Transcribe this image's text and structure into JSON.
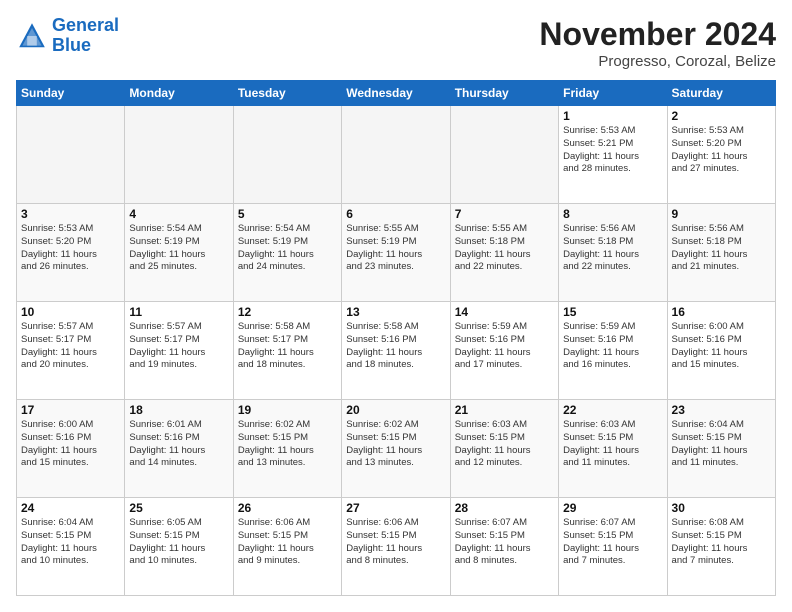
{
  "header": {
    "logo_line1": "General",
    "logo_line2": "Blue",
    "month_title": "November 2024",
    "location": "Progresso, Corozal, Belize"
  },
  "weekdays": [
    "Sunday",
    "Monday",
    "Tuesday",
    "Wednesday",
    "Thursday",
    "Friday",
    "Saturday"
  ],
  "weeks": [
    [
      {
        "day": "",
        "info": ""
      },
      {
        "day": "",
        "info": ""
      },
      {
        "day": "",
        "info": ""
      },
      {
        "day": "",
        "info": ""
      },
      {
        "day": "",
        "info": ""
      },
      {
        "day": "1",
        "info": "Sunrise: 5:53 AM\nSunset: 5:21 PM\nDaylight: 11 hours\nand 28 minutes."
      },
      {
        "day": "2",
        "info": "Sunrise: 5:53 AM\nSunset: 5:20 PM\nDaylight: 11 hours\nand 27 minutes."
      }
    ],
    [
      {
        "day": "3",
        "info": "Sunrise: 5:53 AM\nSunset: 5:20 PM\nDaylight: 11 hours\nand 26 minutes."
      },
      {
        "day": "4",
        "info": "Sunrise: 5:54 AM\nSunset: 5:19 PM\nDaylight: 11 hours\nand 25 minutes."
      },
      {
        "day": "5",
        "info": "Sunrise: 5:54 AM\nSunset: 5:19 PM\nDaylight: 11 hours\nand 24 minutes."
      },
      {
        "day": "6",
        "info": "Sunrise: 5:55 AM\nSunset: 5:19 PM\nDaylight: 11 hours\nand 23 minutes."
      },
      {
        "day": "7",
        "info": "Sunrise: 5:55 AM\nSunset: 5:18 PM\nDaylight: 11 hours\nand 22 minutes."
      },
      {
        "day": "8",
        "info": "Sunrise: 5:56 AM\nSunset: 5:18 PM\nDaylight: 11 hours\nand 22 minutes."
      },
      {
        "day": "9",
        "info": "Sunrise: 5:56 AM\nSunset: 5:18 PM\nDaylight: 11 hours\nand 21 minutes."
      }
    ],
    [
      {
        "day": "10",
        "info": "Sunrise: 5:57 AM\nSunset: 5:17 PM\nDaylight: 11 hours\nand 20 minutes."
      },
      {
        "day": "11",
        "info": "Sunrise: 5:57 AM\nSunset: 5:17 PM\nDaylight: 11 hours\nand 19 minutes."
      },
      {
        "day": "12",
        "info": "Sunrise: 5:58 AM\nSunset: 5:17 PM\nDaylight: 11 hours\nand 18 minutes."
      },
      {
        "day": "13",
        "info": "Sunrise: 5:58 AM\nSunset: 5:16 PM\nDaylight: 11 hours\nand 18 minutes."
      },
      {
        "day": "14",
        "info": "Sunrise: 5:59 AM\nSunset: 5:16 PM\nDaylight: 11 hours\nand 17 minutes."
      },
      {
        "day": "15",
        "info": "Sunrise: 5:59 AM\nSunset: 5:16 PM\nDaylight: 11 hours\nand 16 minutes."
      },
      {
        "day": "16",
        "info": "Sunrise: 6:00 AM\nSunset: 5:16 PM\nDaylight: 11 hours\nand 15 minutes."
      }
    ],
    [
      {
        "day": "17",
        "info": "Sunrise: 6:00 AM\nSunset: 5:16 PM\nDaylight: 11 hours\nand 15 minutes."
      },
      {
        "day": "18",
        "info": "Sunrise: 6:01 AM\nSunset: 5:16 PM\nDaylight: 11 hours\nand 14 minutes."
      },
      {
        "day": "19",
        "info": "Sunrise: 6:02 AM\nSunset: 5:15 PM\nDaylight: 11 hours\nand 13 minutes."
      },
      {
        "day": "20",
        "info": "Sunrise: 6:02 AM\nSunset: 5:15 PM\nDaylight: 11 hours\nand 13 minutes."
      },
      {
        "day": "21",
        "info": "Sunrise: 6:03 AM\nSunset: 5:15 PM\nDaylight: 11 hours\nand 12 minutes."
      },
      {
        "day": "22",
        "info": "Sunrise: 6:03 AM\nSunset: 5:15 PM\nDaylight: 11 hours\nand 11 minutes."
      },
      {
        "day": "23",
        "info": "Sunrise: 6:04 AM\nSunset: 5:15 PM\nDaylight: 11 hours\nand 11 minutes."
      }
    ],
    [
      {
        "day": "24",
        "info": "Sunrise: 6:04 AM\nSunset: 5:15 PM\nDaylight: 11 hours\nand 10 minutes."
      },
      {
        "day": "25",
        "info": "Sunrise: 6:05 AM\nSunset: 5:15 PM\nDaylight: 11 hours\nand 10 minutes."
      },
      {
        "day": "26",
        "info": "Sunrise: 6:06 AM\nSunset: 5:15 PM\nDaylight: 11 hours\nand 9 minutes."
      },
      {
        "day": "27",
        "info": "Sunrise: 6:06 AM\nSunset: 5:15 PM\nDaylight: 11 hours\nand 8 minutes."
      },
      {
        "day": "28",
        "info": "Sunrise: 6:07 AM\nSunset: 5:15 PM\nDaylight: 11 hours\nand 8 minutes."
      },
      {
        "day": "29",
        "info": "Sunrise: 6:07 AM\nSunset: 5:15 PM\nDaylight: 11 hours\nand 7 minutes."
      },
      {
        "day": "30",
        "info": "Sunrise: 6:08 AM\nSunset: 5:15 PM\nDaylight: 11 hours\nand 7 minutes."
      }
    ]
  ]
}
